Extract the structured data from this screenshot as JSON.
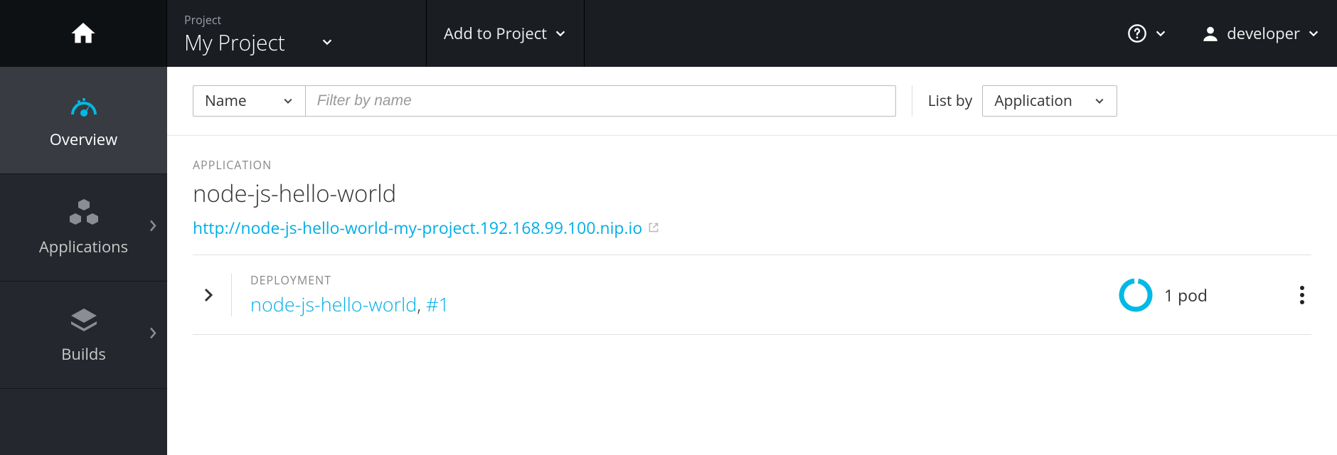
{
  "header": {
    "project_small": "Project",
    "project_name": "My Project",
    "add": "Add to Project",
    "user": "developer"
  },
  "sidebar": {
    "items": [
      {
        "label": "Overview",
        "icon": "dashboard-icon",
        "active": true,
        "has_children": false
      },
      {
        "label": "Applications",
        "icon": "applications-icon",
        "active": false,
        "has_children": true
      },
      {
        "label": "Builds",
        "icon": "builds-icon",
        "active": false,
        "has_children": true
      }
    ]
  },
  "toolbar": {
    "filter_type": "Name",
    "filter_placeholder": "Filter by name",
    "listby_label": "List by",
    "listby_value": "Application"
  },
  "application": {
    "heading_label": "APPLICATION",
    "name": "node-js-hello-world",
    "url": "http://node-js-hello-world-my-project.192.168.99.100.nip.io"
  },
  "deployment": {
    "heading_label": "DEPLOYMENT",
    "name": "node-js-hello-world",
    "revision": "#1",
    "pods_text": "1 pod"
  }
}
